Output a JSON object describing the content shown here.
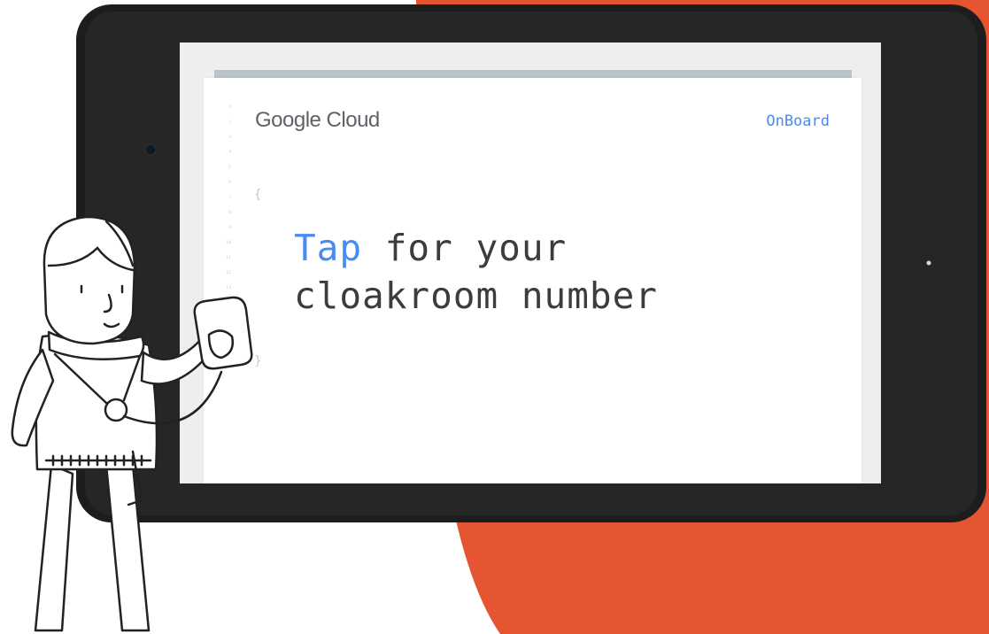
{
  "screen": {
    "brand": "Google Cloud",
    "tag": "OnBoard",
    "headline_accent": "Tap",
    "headline_line1_rest": " for your",
    "headline_line2": "cloakroom number",
    "brace_open": "{",
    "brace_close": "}",
    "line_numbers": [
      "1",
      "2",
      "3",
      "4",
      "5",
      "6",
      "7",
      "8",
      "9",
      "10",
      "11",
      "12",
      "13",
      "14",
      "15",
      "16",
      "17",
      "18"
    ]
  },
  "colors": {
    "accent_blue": "#4a8af4",
    "orange_shape": "#e65532",
    "tablet_body": "#1d1d1d"
  },
  "icons": {
    "phone": "nfc-phone-icon",
    "camera": "camera-lens-icon"
  }
}
